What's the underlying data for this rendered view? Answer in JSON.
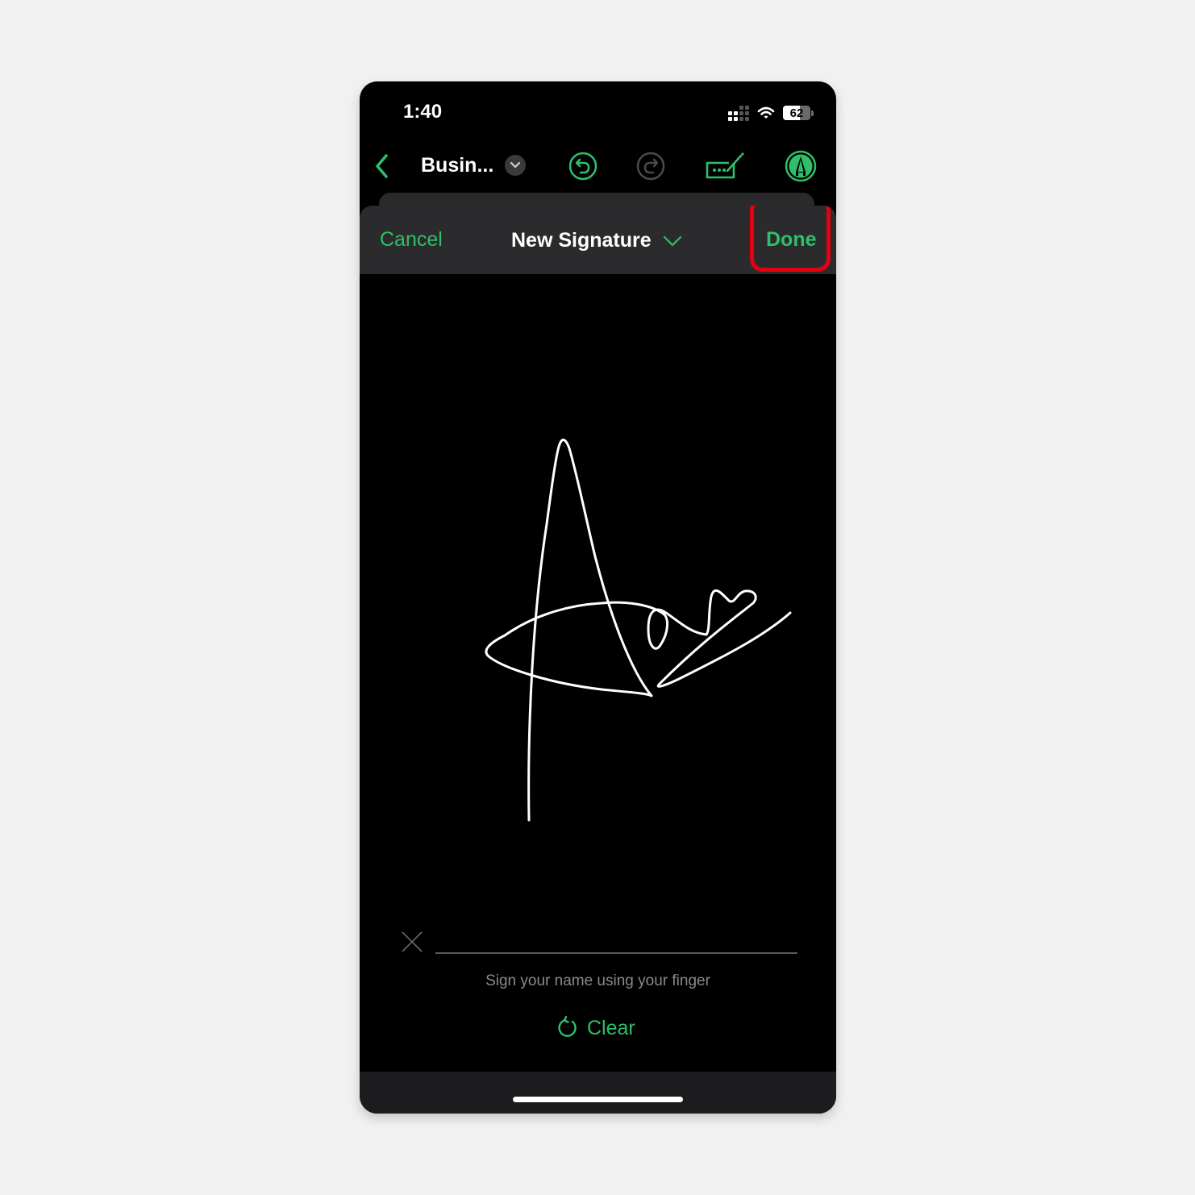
{
  "status_bar": {
    "time": "1:40",
    "battery_level": "62",
    "icons": [
      "cellular-signal-icon",
      "wifi-icon",
      "battery-icon"
    ]
  },
  "toolbar": {
    "back_icon": "chevron-left-icon",
    "document_title": "Busin...",
    "title_menu_icon": "chevron-down-icon",
    "undo_icon": "undo-icon",
    "redo_icon": "redo-icon",
    "signature_icon": "signature-pen-icon",
    "markup_icon": "markup-pen-icon"
  },
  "signature_sheet": {
    "cancel_label": "Cancel",
    "title": "New Signature",
    "title_chevron": "chevron-down-icon",
    "done_label": "Done",
    "hint": "Sign your name using your finger",
    "clear_label": "Clear",
    "clear_icon": "rotate-left-icon"
  },
  "colors": {
    "accent": "#2fbf6a",
    "highlight": "#e60012",
    "header_bg": "#2b2b2d",
    "background": "#000000"
  }
}
